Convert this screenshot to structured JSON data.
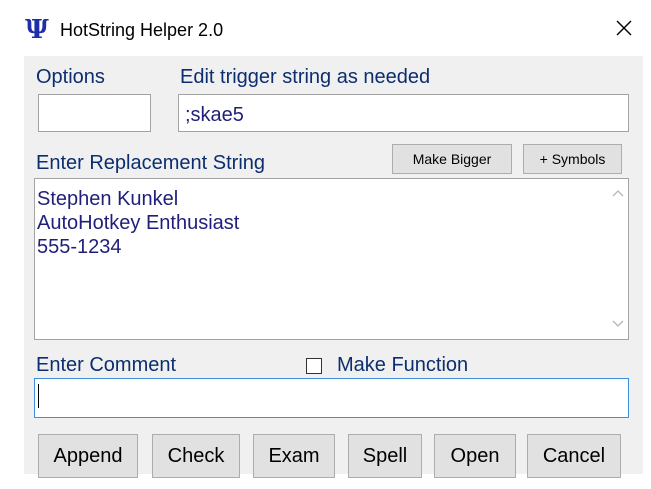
{
  "window": {
    "icon_glyph": "Ψ",
    "title": "HotString Helper 2.0",
    "close_glyph": "✕"
  },
  "options": {
    "label": "Options",
    "value": ""
  },
  "trigger": {
    "label": "Edit trigger string as needed",
    "value": ";skae5"
  },
  "replacement": {
    "label": "Enter Replacement String",
    "make_bigger_label": "Make Bigger",
    "symbols_label": "+ Symbols",
    "lines": [
      "Stephen Kunkel",
      "AutoHotkey Enthusiast",
      "555-1234"
    ]
  },
  "comment": {
    "label": "Enter Comment",
    "value": "",
    "make_function_label": "Make Function",
    "make_function_checked": false
  },
  "buttons": {
    "append": "Append",
    "check": "Check",
    "exam": "Exam",
    "spell": "Spell",
    "open": "Open",
    "cancel": "Cancel"
  },
  "colors": {
    "label_text": "#0c2e6e",
    "field_text": "#1f1f7a",
    "client_background": "#f0f0f0",
    "focus_border": "#3c8fdb",
    "app_icon": "#1f2fa8"
  },
  "icons": {
    "app": "psi-icon",
    "close": "close-icon",
    "scroll_up": "chevron-up-icon",
    "scroll_down": "chevron-down-icon"
  }
}
